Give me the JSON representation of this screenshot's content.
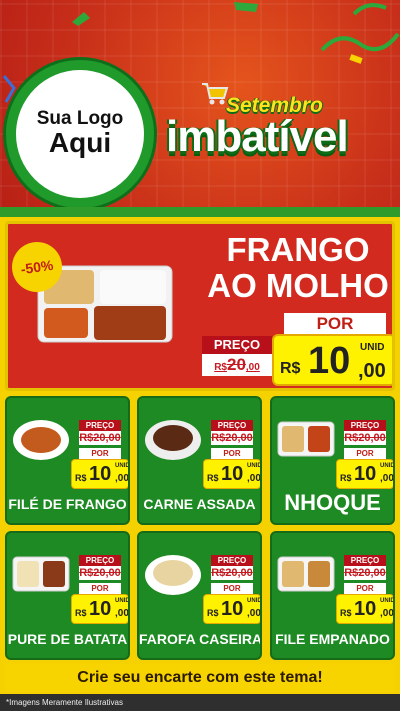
{
  "brand": {
    "logo_line1": "Sua Logo",
    "logo_line2": "Aqui",
    "campaign_top": "Setembro",
    "campaign_main": "imbatível"
  },
  "hero": {
    "discount_badge": "-50%",
    "title_line1": "FRANGO",
    "title_line2": "AO MOLHO",
    "preco_label": "PREÇO",
    "old_price_currency": "R$",
    "old_price_int": "20",
    "old_price_dec": ",00",
    "por_label": "POR",
    "unid_label": "UNID",
    "currency": "R$",
    "price_int": "10",
    "price_dec": ",00"
  },
  "products": [
    {
      "name": "FILÉ DE FRANGO",
      "preco_label": "PREÇO",
      "old_price": "R$20,00",
      "por_label": "POR",
      "currency": "R$",
      "price_int": "10",
      "price_dec": ",00",
      "unid": "UNID"
    },
    {
      "name": "CARNE ASSADA",
      "preco_label": "PREÇO",
      "old_price": "R$20,00",
      "por_label": "POR",
      "currency": "R$",
      "price_int": "10",
      "price_dec": ",00",
      "unid": "UNID"
    },
    {
      "name": "NHOQUE",
      "preco_label": "PREÇO",
      "old_price": "R$20,00",
      "por_label": "POR",
      "currency": "R$",
      "price_int": "10",
      "price_dec": ",00",
      "unid": "UNID"
    },
    {
      "name": "PURE DE BATATA",
      "preco_label": "PREÇO",
      "old_price": "R$20,00",
      "por_label": "POR",
      "currency": "R$",
      "price_int": "10",
      "price_dec": ",00",
      "unid": "UNID"
    },
    {
      "name": "FAROFA CASEIRA",
      "preco_label": "PREÇO",
      "old_price": "R$20,00",
      "por_label": "POR",
      "currency": "R$",
      "price_int": "10",
      "price_dec": ",00",
      "unid": "UNID"
    },
    {
      "name": "FILE EMPANADO",
      "preco_label": "PREÇO",
      "old_price": "R$20,00",
      "por_label": "POR",
      "currency": "R$",
      "price_int": "10",
      "price_dec": ",00",
      "unid": "UNID"
    }
  ],
  "footer": {
    "cta": "Crie seu encarte com este tema!",
    "disclaimer": "*Imagens Meramente Ilustrativas"
  },
  "colors": {
    "header_red": "#c9301a",
    "hero_red": "#d22a1f",
    "card_green": "#1e8a23",
    "yellow": "#f7d300",
    "price_yellow": "#fff200"
  },
  "icons": [
    "shopping-cart-icon",
    "confetti-icon",
    "food-tray-icon",
    "food-bowl-icon"
  ]
}
